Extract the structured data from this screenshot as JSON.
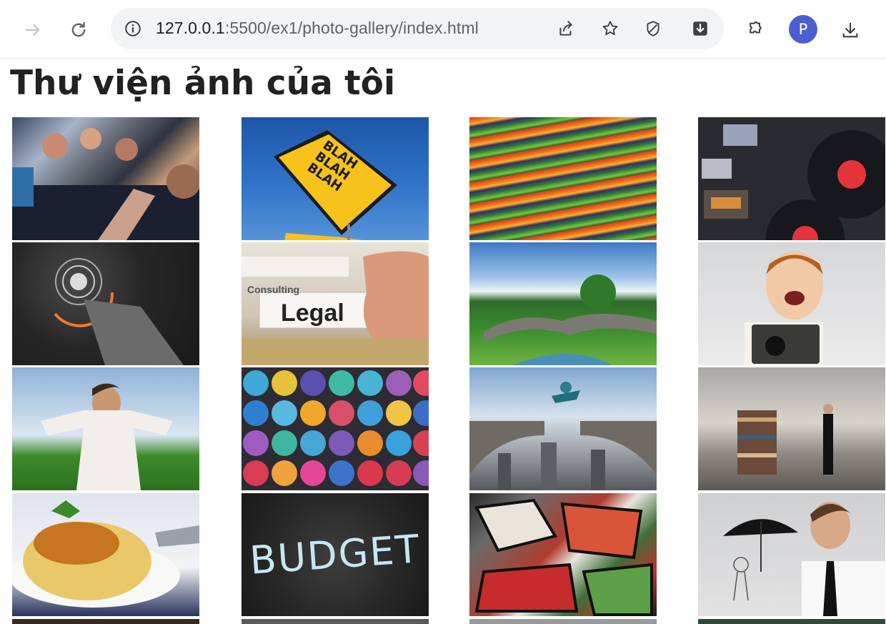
{
  "browser": {
    "url_host": "127.0.0.1",
    "url_rest": ":5500/ex1/photo-gallery/index.html",
    "profile_initial": "P"
  },
  "page": {
    "title": "Thư viện ảnh của tôi"
  },
  "gallery": {
    "image_texts": {
      "sign": "BLAH\nBLAH\nBLAH",
      "legal": "Legal",
      "consulting": "Consulting",
      "budget": "BUDGET"
    }
  }
}
